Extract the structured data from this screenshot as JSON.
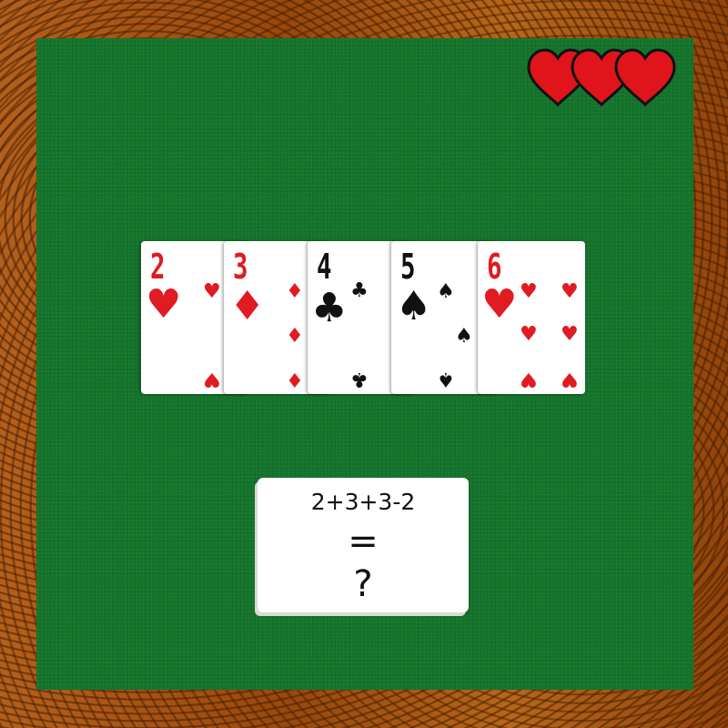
{
  "lives": {
    "count": 3,
    "icon": "heart-icon",
    "color": "#e0151b"
  },
  "cards": [
    {
      "rank": "2",
      "suit": "hearts",
      "suit_glyph": "♥",
      "color": "red"
    },
    {
      "rank": "3",
      "suit": "diamonds",
      "suit_glyph": "♦",
      "color": "red"
    },
    {
      "rank": "4",
      "suit": "clubs",
      "suit_glyph": "♣",
      "color": "black"
    },
    {
      "rank": "5",
      "suit": "spades",
      "suit_glyph": "♠",
      "color": "black"
    },
    {
      "rank": "6",
      "suit": "hearts",
      "suit_glyph": "♥",
      "color": "red"
    }
  ],
  "equation": {
    "expression": "2+3+3-2",
    "equals": "=",
    "answer_placeholder": "?"
  },
  "colors": {
    "felt": "#13732a",
    "wood_frame": "#a8520f",
    "red_suit": "#e01b22",
    "black_suit": "#111111"
  }
}
